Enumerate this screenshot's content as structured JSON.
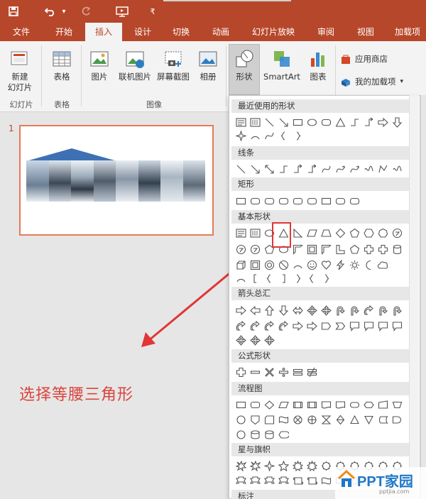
{
  "colors": {
    "accent": "#b7472a",
    "highlight": "#e03636",
    "caption": "#d9453c",
    "watermark": "#1e78c8"
  },
  "quick_access": {
    "save_icon": "save-icon",
    "undo_icon": "undo-icon",
    "undo_drop": "▾",
    "redo_icon": "redo-icon",
    "slideshow_icon": "slideshow-icon",
    "customize": "customize-icon",
    "customize_glyph": "₹"
  },
  "tabs": [
    "文件",
    "开始",
    "插入",
    "设计",
    "切换",
    "动画",
    "幻灯片放映",
    "审阅",
    "视图",
    "加载项"
  ],
  "active_tab": "插入",
  "ribbon": {
    "new_slide": "新建\n幻灯片",
    "table": "表格",
    "picture": "图片",
    "online_picture": "联机图片",
    "screenshot": "屏幕截图",
    "album": "相册",
    "shapes": "形状",
    "smartart": "SmartArt",
    "chart": "图表",
    "store": "应用商店",
    "my_addins": "我的加载项",
    "groups": {
      "slides": "幻灯片",
      "tables": "表格",
      "images": "图像"
    }
  },
  "slide_panel": {
    "slide_number": "1"
  },
  "caption": "选择等腰三角形",
  "gallery": {
    "sections": [
      "最近使用的形状",
      "线条",
      "矩形",
      "基本形状",
      "箭头总汇",
      "公式形状",
      "流程图",
      "星与旗帜",
      "标注"
    ]
  },
  "watermark": {
    "brand": "PPT家园",
    "url": "pptjia.com"
  }
}
